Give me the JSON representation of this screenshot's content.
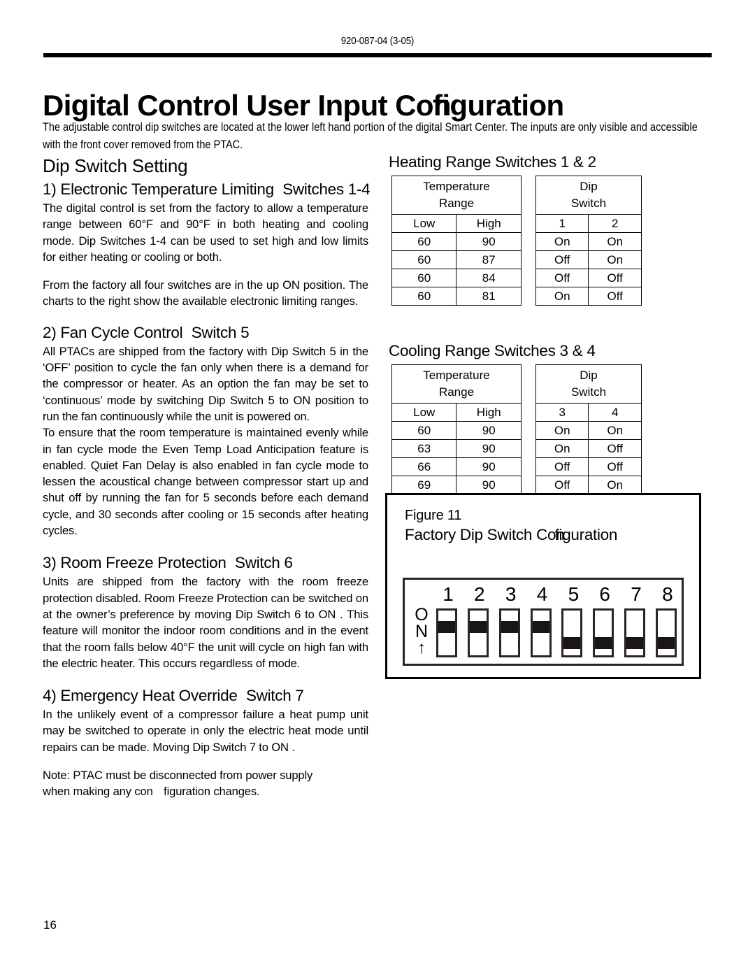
{
  "header": {
    "doc_code": "920-087-04 (3-05)"
  },
  "title": {
    "prefix": "Digital Control User Input ",
    "lig_a": "Con",
    "lig_b": "figuration"
  },
  "intro": "The adjustable control dip switches are located at the lower left hand portion of the digital Smart Center.  The inputs are only visible and accessible with the front cover removed from the PTAC.",
  "left_column": {
    "section_title": "Dip Switch Setting",
    "items": [
      {
        "heading_a": "1) Electronic Temperature Limiting",
        "heading_b": "Switches 1-4",
        "paragraphs": [
          "The digital control is set from the factory to allow a temperature range between 60°F and 90°F in both heating and cooling mode. Dip Switches 1-4 can be used to set high and low limits for either heating or cooling or both.",
          "From the factory all four switches are in the up  ON  position. The charts to the right show the available electronic limiting ranges."
        ]
      },
      {
        "heading_a": "2) Fan Cycle Control",
        "heading_b": "Switch 5",
        "paragraphs": [
          "All PTACs are shipped from the factory with Dip Switch 5 in the ‘OFF’ position to cycle the fan only when there is a demand for the compressor or heater. As an option the fan may be set to ‘continuous’ mode by switching Dip Switch 5 to  ON  position to run the fan continuously while the unit is powered on.",
          "To ensure that the room temperature is maintained evenly while in fan cycle mode the Even Temp Load Anticipation   feature is enabled. Quiet Fan Delay  is also enabled in fan cycle mode to lessen the acoustical change between compressor start up and shut off by running the fan for 5 seconds before each demand cycle, and 30 seconds after cooling or 15 seconds after heating cycles."
        ]
      },
      {
        "heading_a": "3) Room Freeze Protection",
        "heading_b": "Switch 6",
        "paragraphs": [
          "Units are shipped from the factory with the room freeze protection disabled. Room Freeze Protection can be switched on at the owner’s preference by moving Dip Switch 6 to  ON . This feature will monitor the indoor room conditions and in the event that the room falls below 40°F the unit will cycle on high fan with the electric heater. This occurs regardless of mode."
        ]
      },
      {
        "heading_a": "4) Emergency Heat Override",
        "heading_b": "Switch 7",
        "paragraphs": [
          "In the unlikely event of a compressor failure a heat pump unit may be switched to operate in only the electric heat mode until repairs can be made. Moving Dip Switch 7 to  ON ."
        ]
      }
    ],
    "note_line1": "Note: PTAC must be disconnected from power supply",
    "note_line2_a": "when making any con",
    "note_line2_b": "figuration changes."
  },
  "right_column": {
    "heating": {
      "heading": "Heating Range Switches 1 & 2",
      "temp_header": "Temperature Range",
      "temp_header_l1": "Temperature",
      "temp_header_l2": "Range",
      "dip_header_l1": "Dip",
      "dip_header_l2": "Switch",
      "temp_cols": [
        "Low",
        "High"
      ],
      "dip_cols": [
        "1",
        "2"
      ],
      "temp_rows": [
        [
          "60",
          "90"
        ],
        [
          "60",
          "87"
        ],
        [
          "60",
          "84"
        ],
        [
          "60",
          "81"
        ]
      ],
      "dip_rows": [
        [
          "On",
          "On"
        ],
        [
          "Off",
          "On"
        ],
        [
          "Off",
          "Off"
        ],
        [
          "On",
          "Off"
        ]
      ]
    },
    "cooling": {
      "heading": "Cooling Range Switches 3 & 4",
      "temp_header_l1": "Temperature",
      "temp_header_l2": "Range",
      "dip_header_l1": "Dip",
      "dip_header_l2": "Switch",
      "temp_cols": [
        "Low",
        "High"
      ],
      "dip_cols": [
        "3",
        "4"
      ],
      "temp_rows": [
        [
          "60",
          "90"
        ],
        [
          "63",
          "90"
        ],
        [
          "66",
          "90"
        ],
        [
          "69",
          "90"
        ]
      ],
      "dip_rows": [
        [
          "On",
          "On"
        ],
        [
          "On",
          "Off"
        ],
        [
          "Off",
          "Off"
        ],
        [
          "Off",
          "On"
        ]
      ]
    },
    "figure": {
      "label": "Figure 11",
      "caption_a": "Factory Dip Switch Con",
      "caption_b": "figuration",
      "on_label_line1": "O",
      "on_label_line2": "N",
      "arrow": "↑",
      "switches": [
        {
          "number": "1",
          "position": "on"
        },
        {
          "number": "2",
          "position": "on"
        },
        {
          "number": "3",
          "position": "on"
        },
        {
          "number": "4",
          "position": "on"
        },
        {
          "number": "5",
          "position": "off"
        },
        {
          "number": "6",
          "position": "off"
        },
        {
          "number": "7",
          "position": "off"
        },
        {
          "number": "8",
          "position": "off"
        }
      ]
    }
  },
  "page_number": "16"
}
